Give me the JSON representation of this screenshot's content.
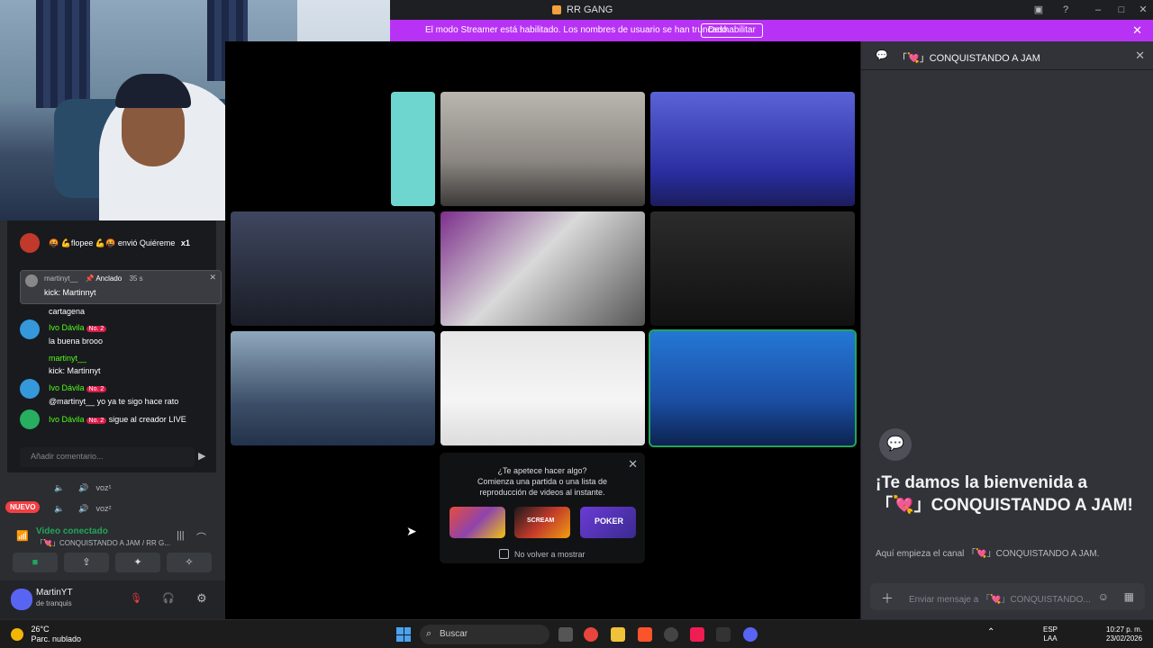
{
  "window": {
    "title": "RR GANG"
  },
  "banner": {
    "text": "El modo Streamer está habilitado. Los nombres de usuario se han truncado.",
    "button": "Deshabilitar"
  },
  "chat_overlay": {
    "gift": "🤬 💪flopee 💪🤬 envió Quiéreme",
    "gift_count": "x1",
    "pinned_user": "martinyt__",
    "pinned_badge": "📌 Anclado",
    "pinned_time": "35 s",
    "pinned_text": "kick: Martinnyt",
    "messages": [
      {
        "user": "",
        "text": "cartagena"
      },
      {
        "user": "Ivo Dávila",
        "rank": "No. 2",
        "text": ""
      },
      {
        "user": "",
        "text": "la buena brooo"
      },
      {
        "user": "martinyt__",
        "text": ""
      },
      {
        "user": "",
        "text": "kick: Martinnyt"
      },
      {
        "user": "Ivo Dávila",
        "rank": "No. 2",
        "text": ""
      },
      {
        "user": "",
        "text": "@martinyt__ yo ya te sigo hace rato"
      },
      {
        "user": "Ivo Dávila",
        "rank": "No. 2",
        "text": "sigue al creador LIVE"
      }
    ],
    "comment_placeholder": "Añadir comentario..."
  },
  "sidebar": {
    "voice_items": [
      "voz¹",
      "voz²"
    ],
    "new_badge": "NUEVO",
    "voice_status": "Video conectado",
    "voice_channel": "「💘」CONQUISTANDO A JAM / RR G...",
    "user": {
      "name": "MartinYT",
      "status": "de tranquis"
    }
  },
  "activity": {
    "heading": "¿Te apetece hacer algo?",
    "body": "Comienza una partida o una lista de reproducción de videos al instante.",
    "cards": [
      "",
      "SCREAM",
      "POKER"
    ],
    "checkbox": "No volver a mostrar"
  },
  "right_panel": {
    "channel": "「💘」CONQUISTANDO A JAM",
    "welcome": "¡Te damos la bienvenida a 「💘」CONQUISTANDO A JAM!",
    "welcome_sub": "Aquí empieza el canal 「💘」CONQUISTANDO A JAM.",
    "placeholder": "Enviar mensaje a 「💘」CONQUISTANDO..."
  },
  "taskbar": {
    "temp": "26°C",
    "weather": "Parc. nublado",
    "search": "Buscar",
    "lang1": "ESP",
    "lang2": "LAA",
    "time": "10:27 p. m.",
    "date": "23/02/2026"
  },
  "colors": {
    "banner": "#b832f5",
    "accent_green": "#23a55a",
    "discord_bg": "#313338"
  }
}
